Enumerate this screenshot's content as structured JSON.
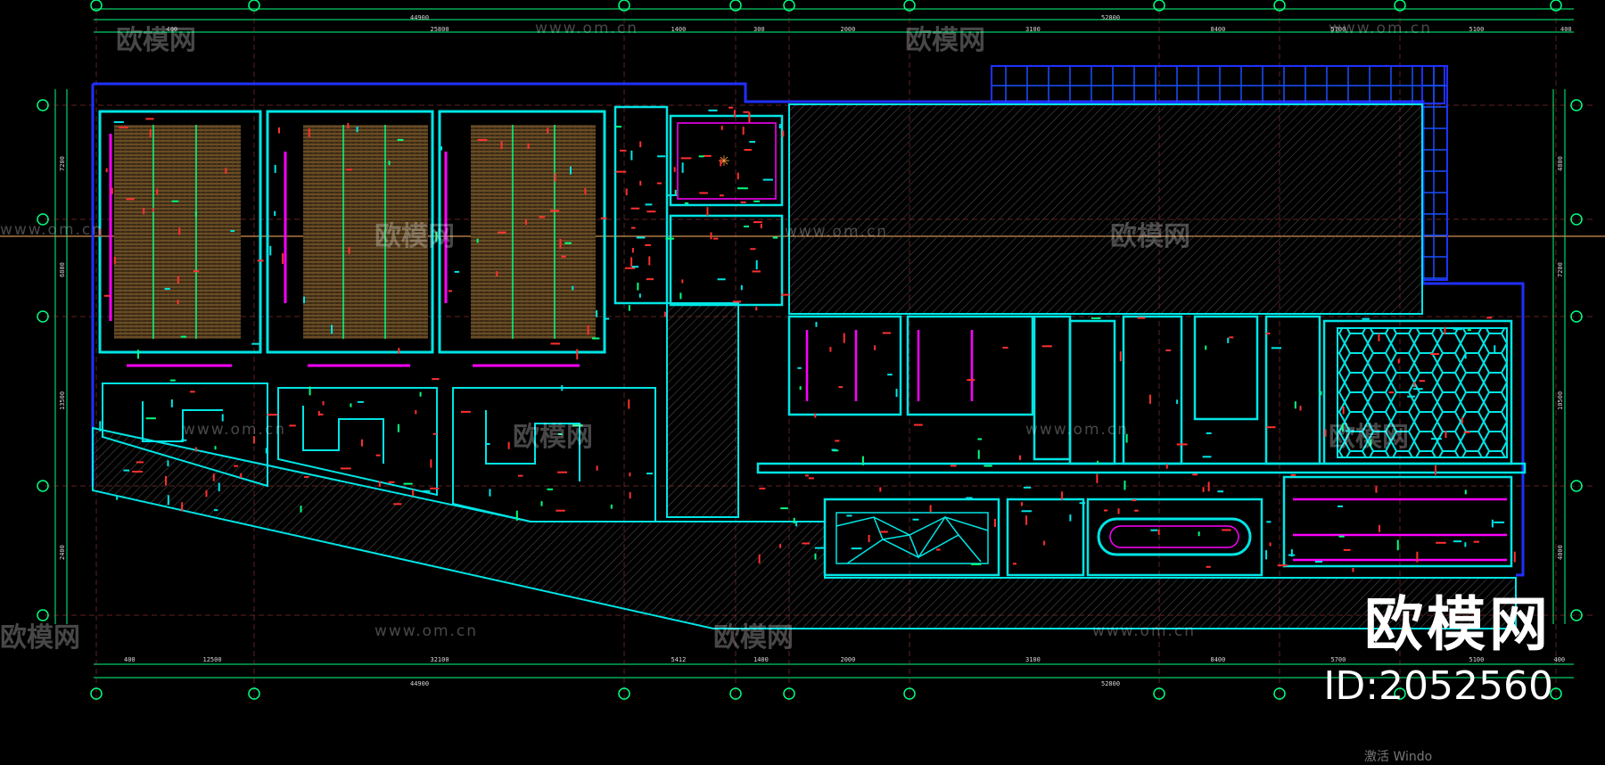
{
  "watermark": {
    "brand": "欧模网",
    "url": "www.om.cn",
    "id_text": "ID:2052560",
    "bottom_text": "激活 Windo"
  },
  "dimensions": {
    "top_overall_left": "44900",
    "top_overall_right": "52800",
    "top_segments": [
      "400",
      "25800",
      "1400",
      "300",
      "2000",
      "3100",
      "8400",
      "5700",
      "5100",
      "400"
    ],
    "bottom_overall_left": "44900",
    "bottom_overall_right": "52800",
    "bottom_segments": [
      "400",
      "12500",
      "32100",
      "5412",
      "1400",
      "2000",
      "3100",
      "8400",
      "5700",
      "5100",
      "400"
    ],
    "left_segments": [
      "7200",
      "6800",
      "13500",
      "2400"
    ],
    "right_segments": [
      "4800",
      "7200",
      "10500",
      "4000"
    ]
  },
  "colors": {
    "background": "#000000",
    "wall_cyan": "#00e5e5",
    "green": "#00ff80",
    "magenta": "#ff00ff",
    "red": "#ff3030",
    "blue": "#2030ff",
    "orange": "#ffa040",
    "grey_hatch": "#5a5a5a",
    "watermark": "#ffffff"
  }
}
